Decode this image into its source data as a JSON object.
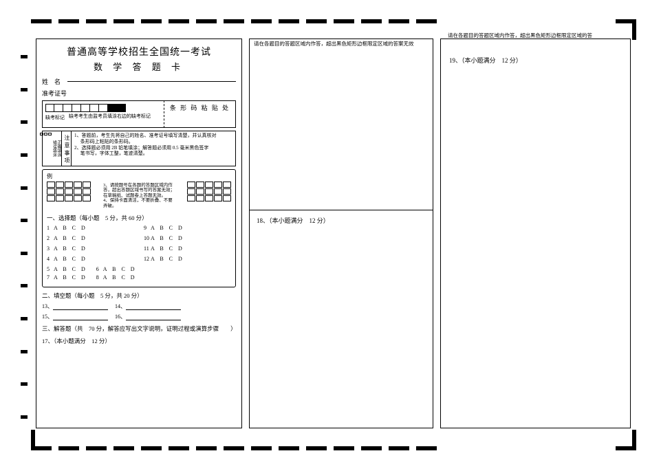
{
  "header": {
    "title_main": "普通高等学校招生全国统一考试",
    "title_sub": "数 学 答 题 卡"
  },
  "labels": {
    "name": "姓　名",
    "ticket": "准考证号",
    "absent": "缺考标记",
    "absent_note": "缺考考生由监考员填涂右边的缺考标记",
    "barcode": "条 形 码 粘 贴 处",
    "fill_side": "填涂样例",
    "fill_correct": "正确填涂",
    "fill_wrong": "错误填涂",
    "notice_head": "注意事项",
    "example": "例"
  },
  "notice_lines": [
    "1、答题前，考生先将自己的姓名、准考证号填写清楚，并认真核对",
    "　 条形码上粘贴的条形码。",
    "2、选择题必须用 2B 铅笔填涂；解答题必须用 0.5 毫米黑色签字",
    "　 笔书写，字体工整，笔迹清楚。",
    "3、请按题号在各题的答题区域内作答，超出答题区域书写的答案无效；在草稿纸、试题卷上答题无效。",
    "4、保持卡面清洁，不要折叠、不要弄破。"
  ],
  "section1": {
    "title": "一、选择题（每小题　5 分，共 60 分）",
    "options": "A　B　C　D",
    "rows": [
      {
        "n": "1",
        "opts": "A　B　C　D",
        "n2": "5",
        "opts2": "A　B　C　D",
        "n3": "9",
        "opts3": "A　B　C　D"
      },
      {
        "n": "2",
        "opts": "A　B　C　D",
        "n2": "6",
        "opts2": "A　B　C　D",
        "n3": "10",
        "opts3": "A　B　C　D"
      },
      {
        "n": "3",
        "opts": "A　B　C　D",
        "n2": "7",
        "opts2": "A　B　C　D",
        "n3": "11",
        "opts3": "A　B　C　D"
      },
      {
        "n": "4",
        "opts": "A　B　C　D",
        "n2": "8",
        "opts2": "A　B　C　D",
        "n3": "12",
        "opts3": "A　B　C　D"
      }
    ]
  },
  "section2": {
    "title": "二、填空题（每小题　5 分，共 20 分）",
    "q13": "13、",
    "q14": "14、",
    "q15": "15、",
    "q16": "16、"
  },
  "section3": {
    "title": "三、解答题（共　70 分，解答应写出文字说明，证明过程或演算步骤　　）",
    "q17": "17、（本小题满分　12 分）"
  },
  "panel2": {
    "topnote": "请在各题目的答题区域内作答，超出黑色矩形边框限定区域的答案无效",
    "q18": "18、（本小题满分　12 分）"
  },
  "panel3": {
    "topnote": "请在各题目的答题区域内作答，超出黑色矩形边框限定区域的答",
    "q19": "19、（本小题满分　12 分）"
  }
}
